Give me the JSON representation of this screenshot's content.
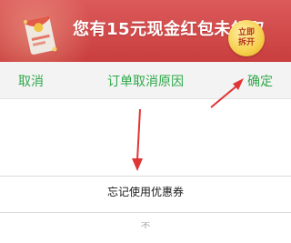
{
  "banner": {
    "message": "您有15元现金红包未领取",
    "open_button": {
      "line1": "立即",
      "line2": "拆开"
    },
    "icon": "red-packet-icon"
  },
  "picker": {
    "cancel_label": "取消",
    "title": "订单取消原因",
    "confirm_label": "确定"
  },
  "options": {
    "selected": "忘记使用优惠券",
    "next": "不"
  },
  "colors": {
    "banner_red": "#d24a4a",
    "accent_green": "#2ea84a",
    "annotation_red": "#e03535",
    "button_gold": "#f6cf4b"
  }
}
